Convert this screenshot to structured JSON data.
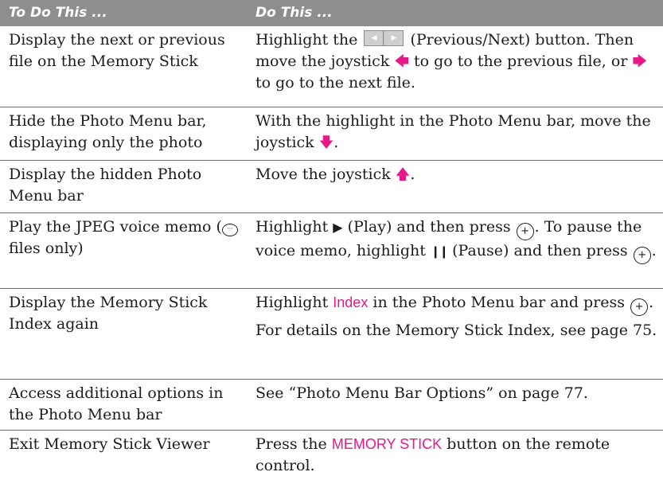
{
  "header": {
    "col1": "To Do This ...",
    "col2": "Do This ..."
  },
  "rows": [
    {
      "todo": "Display the next or previous file on the Memory Stick",
      "do_a": "Highlight the",
      "do_b": "(Previous/Next) button. Then move the joystick",
      "do_c": "to go to the previous file, or",
      "do_d": "to go to the next file."
    },
    {
      "todo": "Hide the Photo Menu bar, displaying only the photo",
      "do_a": "With the highlight in the Photo Menu bar, move the joystick",
      "do_b": "."
    },
    {
      "todo": "Display the hidden Photo Menu bar",
      "do_a": "Move the joystick",
      "do_b": "."
    },
    {
      "todo_a": "Play the JPEG voice memo (",
      "todo_b": "files only)",
      "do_a": "Highlight",
      "do_b": "(Play) and then press",
      "do_c": ". To pause the voice memo, highlight",
      "do_d": "(Pause) and then press",
      "do_e": "."
    },
    {
      "todo": "Display the Memory Stick Index again",
      "do_a": "Highlight",
      "do_hl": "Index",
      "do_b": "in the Photo Menu bar and press",
      "do_c": ".",
      "do_p2": "For details on the Memory Stick Index, see page 75."
    },
    {
      "todo": "Access additional options in the Photo Menu bar",
      "do_a": "See “Photo Menu Bar Options” on page 77."
    },
    {
      "todo": "Exit Memory Stick Viewer",
      "do_a": "Press the",
      "do_hl": "MEMORY STICK",
      "do_b": "button on the remote control."
    }
  ],
  "colors": {
    "header_bg": "#8e8e8e",
    "accent": "#e8178a"
  },
  "icons": [
    "arrow-left-icon",
    "arrow-right-icon",
    "arrow-down-icon",
    "arrow-up-icon",
    "play-icon",
    "pause-icon",
    "enter-button-icon",
    "voice-memo-icon",
    "previous-next-button-icon"
  ]
}
